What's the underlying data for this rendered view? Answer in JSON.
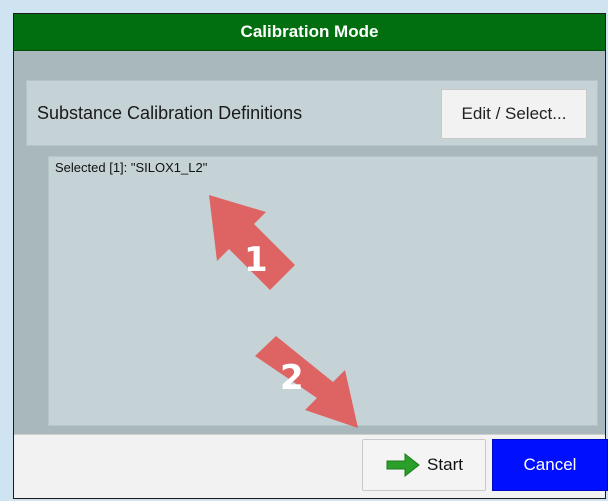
{
  "window": {
    "title": "Calibration Mode"
  },
  "header": {
    "label": "Substance Calibration Definitions",
    "edit_button": "Edit / Select..."
  },
  "selection_list": {
    "items": [
      "Selected [1]: \"SILOX1_L2\""
    ]
  },
  "footer": {
    "start_label": "Start",
    "cancel_label": "Cancel"
  },
  "annotations": [
    {
      "label": "1",
      "color": "#e05a5a"
    },
    {
      "label": "2",
      "color": "#e05a5a"
    }
  ],
  "colors": {
    "title_bar": "#016f0f",
    "cancel": "#0010ff",
    "start_arrow": "#2aa02a",
    "annotation_arrow": "#e05a5a"
  },
  "icons": {
    "start": "right-arrow-icon"
  }
}
